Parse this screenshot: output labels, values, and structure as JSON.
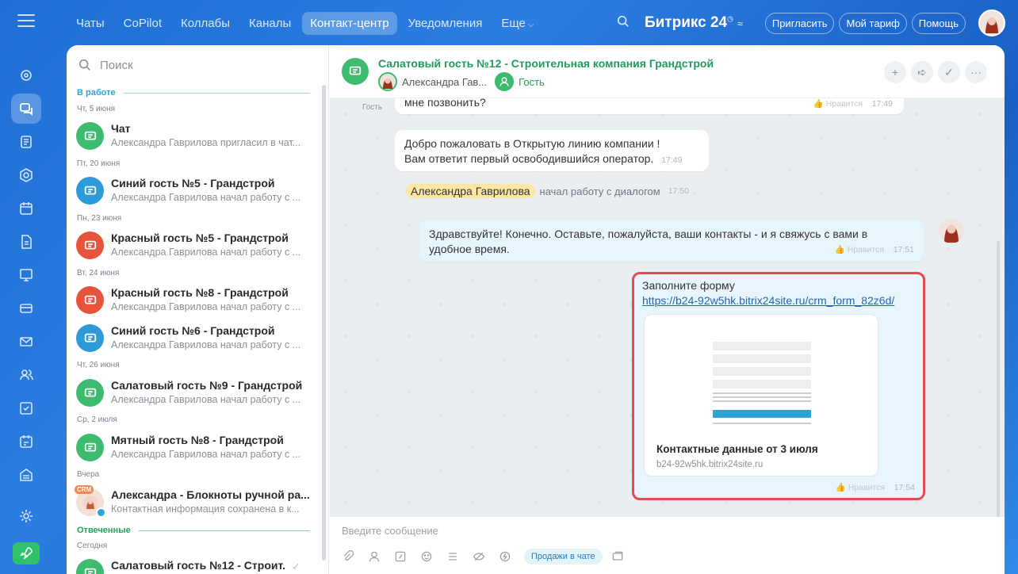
{
  "topbar": {
    "tabs": [
      {
        "label": "Чаты"
      },
      {
        "label": "CoPilot"
      },
      {
        "label": "Коллабы"
      },
      {
        "label": "Каналы"
      },
      {
        "label": "Контакт-центр",
        "active": true
      },
      {
        "label": "Уведомления"
      },
      {
        "label": "Еще"
      }
    ],
    "brand": "Битрикс 24",
    "invite": "Пригласить",
    "tariff": "Мой тариф",
    "help": "Помощь"
  },
  "sidebar": {
    "search_placeholder": "Поиск",
    "section_work": "В работе",
    "section_answered": "Отвеченные",
    "dates": [
      "Чт, 5 июня",
      "Пт, 20 июня",
      "Пн, 23 июня",
      "Вт, 24 июня",
      "Чт, 26 июня",
      "Ср, 2 июля",
      "Вчера",
      "Сегодня"
    ],
    "items": [
      {
        "title": "Чат",
        "subtitle": "Александра Гаврилова пригласил в чат...",
        "color": "green"
      },
      {
        "title": "Синий гость №5 - Грандстрой",
        "subtitle": "Александра Гаврилова начал работу с ...",
        "color": "blue"
      },
      {
        "title": "Красный гость №5 - Грандстрой",
        "subtitle": "Александра Гаврилова начал работу с ...",
        "color": "red"
      },
      {
        "title": "Красный гость №8 - Грандстрой",
        "subtitle": "Александра Гаврилова начал работу с ...",
        "color": "red"
      },
      {
        "title": "Синий гость №6 - Грандстрой",
        "subtitle": "Александра Гаврилова начал работу с ...",
        "color": "blue"
      },
      {
        "title": "Салатовый гость №9 - Грандстрой",
        "subtitle": "Александра Гаврилова начал работу с ...",
        "color": "green"
      },
      {
        "title": "Мятный гость №8 - Грандстрой",
        "subtitle": "Александра Гаврилова начал работу с ...",
        "color": "green"
      },
      {
        "title": "Александра - Блокноты ручной ра...",
        "subtitle": "Контактная информация сохранена в к...",
        "color": "photo",
        "badge": "CRM"
      },
      {
        "title": "Салатовый гость №12 - Строит...",
        "subtitle": "",
        "color": "green"
      }
    ]
  },
  "chat": {
    "title": "Салатовый гость №12 - Строительная компания Грандстрой",
    "operator": "Александра Гав...",
    "guest": "Гость",
    "input_placeholder": "Введите сообщение",
    "sales_label": "Продажи в чате",
    "messages": {
      "m0_sender": "Гость",
      "m0_text": "мне позвонить?",
      "m0_like": "Нравится",
      "m0_time": "17:49",
      "m1_line1": "Добро пожаловать в Открытую линию компании !",
      "m1_line2": "Вам ответит первый освободившийся оператор.",
      "m1_time": "17:49",
      "sys_name": "Александра Гаврилова",
      "sys_text": "начал работу с диалогом",
      "sys_time": "17:50",
      "m2_text": "Здравствуйте! Конечно. Оставьте, пожалуйста, ваши контакты - и я свяжусь с вами в удобное время.",
      "m2_like": "Нравится",
      "m2_time": "17:51",
      "m3_text": "Заполните форму",
      "m3_link": "https://b24-92w5hk.bitrix24site.ru/crm_form_82z6d/",
      "m3_card_title": "Контактные данные от 3 июля",
      "m3_card_url": "b24-92w5hk.bitrix24site.ru",
      "m3_like": "Нравится",
      "m3_time": "17:54"
    }
  },
  "colors": {
    "accent_green": "#3dbb6e",
    "highlight_border": "#e24a55",
    "link": "#2066b0"
  }
}
